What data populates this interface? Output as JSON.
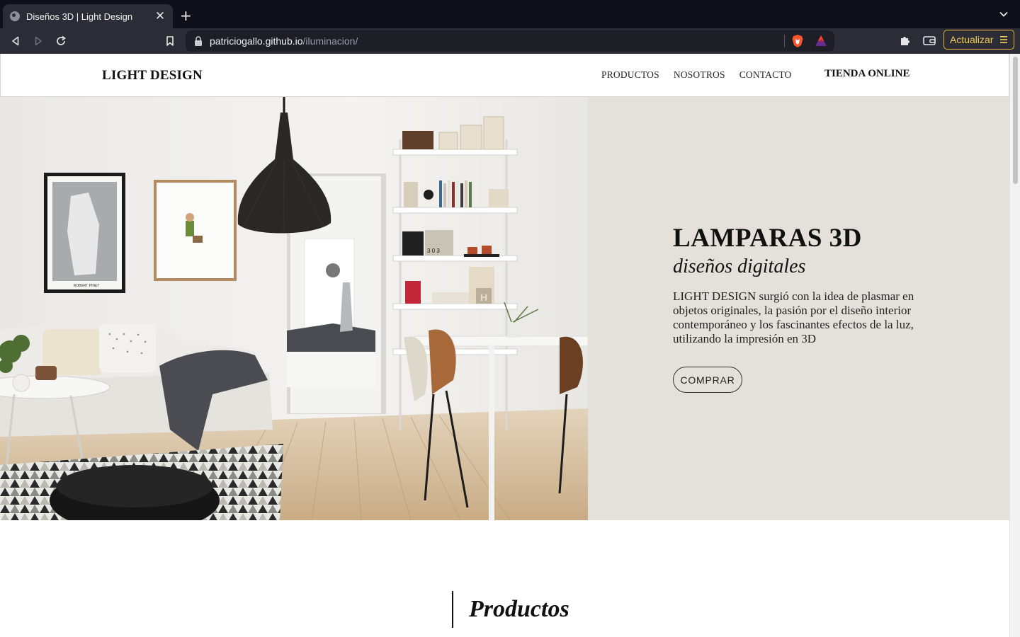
{
  "browser": {
    "tab_title": "Diseños 3D | Light Design",
    "tab_close": "✕",
    "new_tab": "+",
    "url_host": "patriciogallo.github.io",
    "url_path": "/iluminacion/",
    "update_label": "Actualizar",
    "accent_color": "#e3b83b",
    "icons": [
      "globe-icon",
      "close-icon",
      "plus-icon",
      "chevron-down-icon",
      "back-icon",
      "forward-icon",
      "reload-icon",
      "bookmark-icon",
      "lock-icon",
      "brave-shield-icon",
      "bat-rewards-icon",
      "extensions-icon",
      "wallet-icon",
      "menu-icon"
    ]
  },
  "header": {
    "logo": "LIGHT DESIGN",
    "nav": [
      "PRODUCTOS",
      "NOSOTROS",
      "CONTACTO"
    ],
    "shop": "TIENDA ONLINE"
  },
  "hero": {
    "title_main": "LAMPARAS ",
    "title_bold": "3D",
    "subtitle": "diseños digitales",
    "text": "LIGHT DESIGN surgió con la idea de plasmar en objetos originales, la pasión por el diseño interior contemporáneo y los fascinantes efectos de la luz, utilizando la impresión en 3D",
    "button": "COMPRAR",
    "panel_color": "#e4e0da"
  },
  "frames": {
    "poster_caption": "ROBERT PINET"
  },
  "shelf": {
    "calendar": "3 0 3",
    "box_letter": "H"
  },
  "products": {
    "title": "Productos"
  }
}
